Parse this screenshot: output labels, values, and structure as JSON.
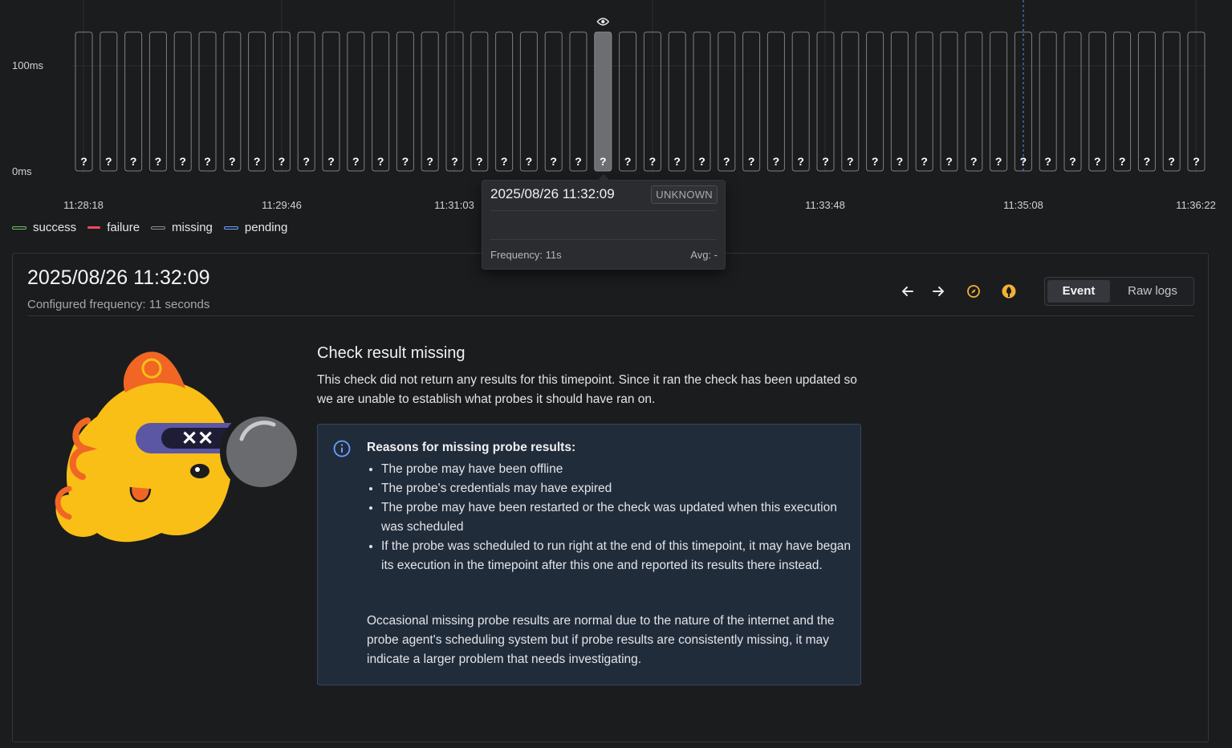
{
  "chart_data": {
    "type": "bar",
    "title": "",
    "xlabel": "",
    "ylabel": "",
    "yticks": [
      "100ms",
      "0ms"
    ],
    "xticks": [
      "11:28:18",
      "11:29:46",
      "11:31:03",
      "11:33:48",
      "11:35:08",
      "11:36:22"
    ],
    "bar_count": 46,
    "bar_symbol": "?",
    "status": "missing",
    "highlighted_index": 21,
    "highlight_icon": "eye-icon",
    "ylim": [
      "0ms",
      "100ms"
    ],
    "grid": true
  },
  "legend": [
    {
      "label": "success",
      "color": "#73bf69"
    },
    {
      "label": "failure",
      "color": "#f2495c"
    },
    {
      "label": "missing",
      "color": "#8e9096"
    },
    {
      "label": "pending",
      "color": "#6e9fff"
    }
  ],
  "tooltip": {
    "time": "2025/08/26 11:32:09",
    "badge": "UNKNOWN",
    "frequency": "Frequency: 11s",
    "avg": "Avg: -"
  },
  "panel": {
    "title": "2025/08/26 11:32:09",
    "subtitle": "Configured frequency: 11 seconds",
    "toolbar": {
      "prev_icon": "arrow-left-icon",
      "next_icon": "arrow-right-icon",
      "explore_icon": "compass-icon",
      "probe_icon": "probe-icon",
      "tab_event": "Event",
      "tab_raw_logs": "Raw logs"
    },
    "heading": "Check result missing",
    "description": "This check did not return any results for this timepoint. Since it ran the check has been updated so we are unable to establish what probes it should have ran on.",
    "info": {
      "title": "Reasons for missing probe results:",
      "items": [
        "The probe may have been offline",
        "The probe's credentials may have expired",
        "The probe may have been restarted or the check was updated when this execution was scheduled",
        "If the probe was scheduled to run right at the end of this timepoint, it may have began its execution in the timepoint after this one and reported its results there instead."
      ],
      "footer": "Occasional missing probe results are normal due to the nature of the internet and the probe agent's scheduling system but if probe results are consistently missing, it may indicate a larger problem that needs investigating."
    }
  },
  "colors": {
    "accent_yellow": "#f2b134",
    "info_blue": "#6e9fff"
  }
}
